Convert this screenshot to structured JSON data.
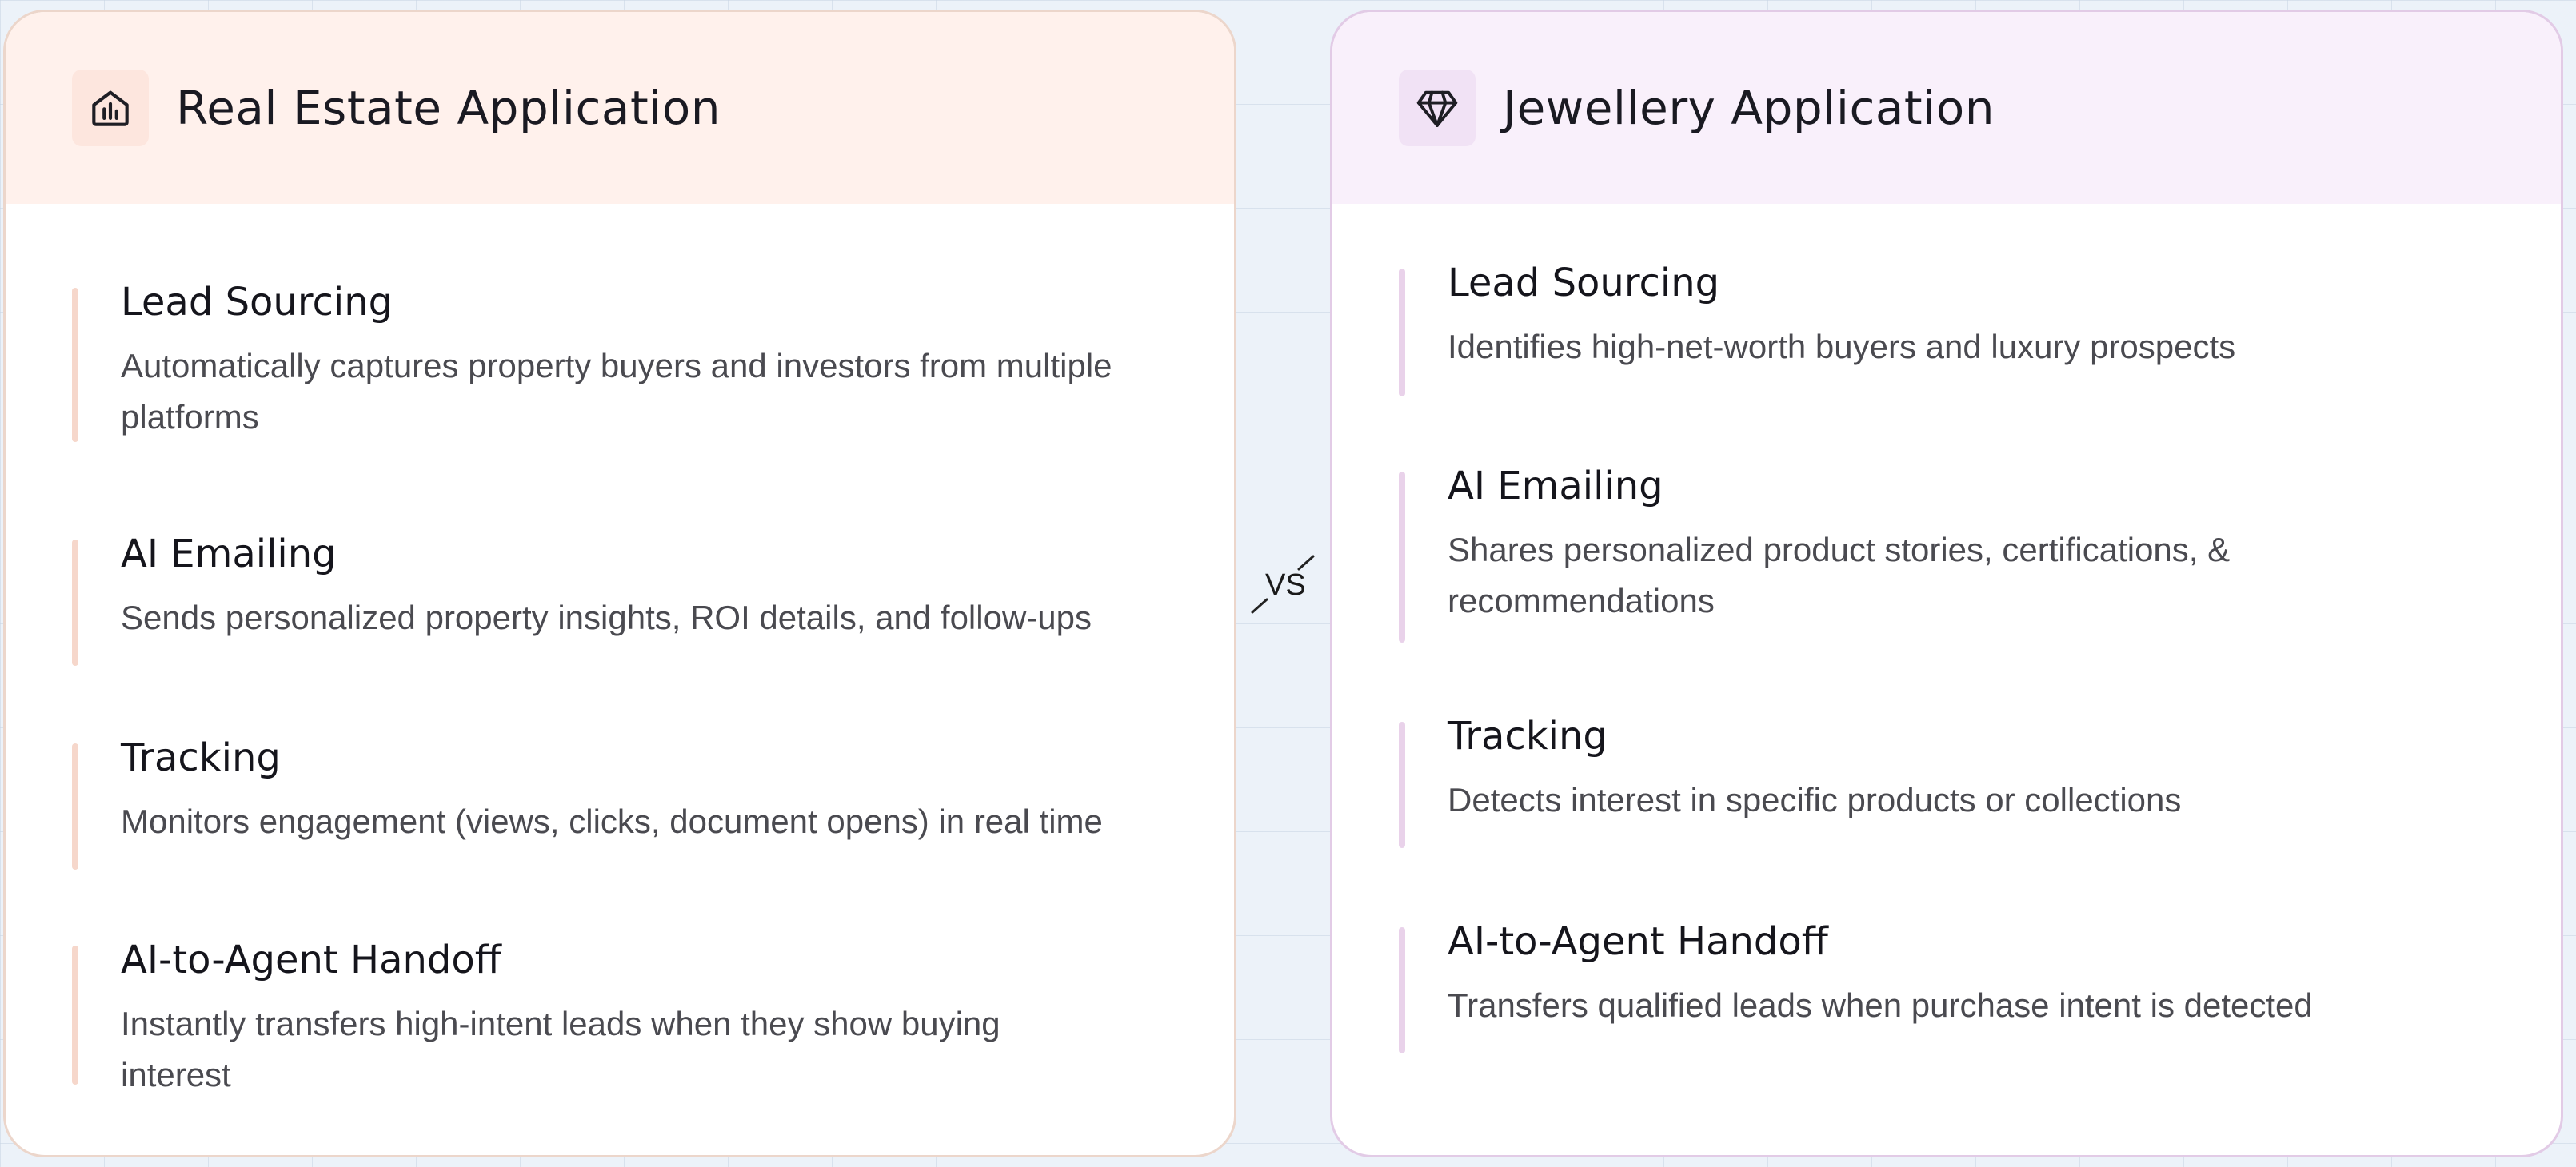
{
  "separator": "VS",
  "cards": [
    {
      "title": "Real Estate Application",
      "icon": "house-chart-icon",
      "accent": "#f6d7cb",
      "features": [
        {
          "title": "Lead Sourcing",
          "description": "Automatically captures property buyers and investors from multiple platforms"
        },
        {
          "title": "AI Emailing",
          "description": "Sends personalized property insights, ROI details, and follow-ups"
        },
        {
          "title": "Tracking",
          "description": "Monitors engagement (views, clicks, document opens) in real time"
        },
        {
          "title": "AI-to-Agent Handoff",
          "description": "Instantly transfers high-intent leads when they show buying interest"
        }
      ]
    },
    {
      "title": "Jewellery Application",
      "icon": "diamond-icon",
      "accent": "#e9d2ea",
      "features": [
        {
          "title": "Lead Sourcing",
          "description": "Identifies high-net-worth buyers and luxury prospects"
        },
        {
          "title": "AI Emailing",
          "description": "Shares personalized product stories, certifications, & recommendations"
        },
        {
          "title": "Tracking",
          "description": "Detects interest in specific products or collections"
        },
        {
          "title": "AI-to-Agent Handoff",
          "description": "Transfers qualified leads when purchase intent is detected"
        }
      ]
    }
  ]
}
